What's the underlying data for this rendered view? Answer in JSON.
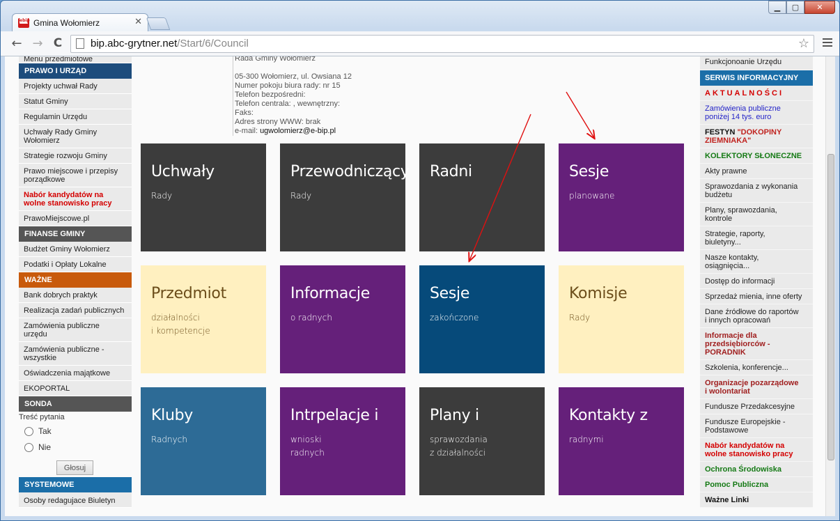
{
  "browser": {
    "tab_title": "Gmina Wołomierz",
    "favicon_text": "ebip",
    "url_host": "bip.abc-grytner.net",
    "url_path": "/Start/6/Council",
    "close_glyph": "✕",
    "min_glyph": "▁",
    "max_glyph": "▢",
    "back_glyph": "←",
    "forward_glyph": "→",
    "reload_glyph": "C",
    "star_glyph": "☆"
  },
  "left_sidebar": {
    "top_item": "Menu przedmiotowe",
    "sections": [
      {
        "header": "PRAWO I URZĄD",
        "color": "#1d4c7c",
        "items": [
          {
            "label": "Projekty uchwał Rady",
            "style": ""
          },
          {
            "label": "Statut Gminy",
            "style": ""
          },
          {
            "label": "Regulamin Urzędu",
            "style": ""
          },
          {
            "label": "Uchwały Rady Gminy\nWołomierz",
            "style": ""
          },
          {
            "label": "Strategie rozwoju Gminy",
            "style": ""
          },
          {
            "label": "Prawo miejscowe i przepisy\nporządkowe",
            "style": ""
          },
          {
            "label": "Nabór kandydatów na\nwolne stanowisko pracy",
            "style": "red"
          },
          {
            "label": "PrawoMiejscowe.pl",
            "style": ""
          }
        ]
      },
      {
        "header": "FINANSE GMINY",
        "color": "#555555",
        "items": [
          {
            "label": "Budżet Gminy Wołomierz",
            "style": ""
          },
          {
            "label": "Podatki i Opłaty Lokalne",
            "style": ""
          }
        ]
      },
      {
        "header": "WAŻNE",
        "color": "#c85a0c",
        "items": [
          {
            "label": "Bank dobrych praktyk",
            "style": ""
          },
          {
            "label": "Realizacja zadań publicznych",
            "style": ""
          },
          {
            "label": "Zamówienia publiczne\nurzędu",
            "style": ""
          },
          {
            "label": "Zamówienia publiczne -\nwszystkie",
            "style": ""
          },
          {
            "label": "Oświadczenia majątkowe",
            "style": ""
          },
          {
            "label": "EKOPORTAL",
            "style": ""
          }
        ]
      }
    ],
    "poll": {
      "header": "SONDA",
      "question": "Treść pytania",
      "options": [
        "Tak",
        "Nie"
      ],
      "button": "Głosuj"
    },
    "system": {
      "header": "SYSTEMOWE",
      "items": [
        "Osoby redagujace Biuletyn"
      ]
    }
  },
  "contact": {
    "name": "Rada Gminy Wołomierz",
    "address": "05-300 Wołomierz, ul. Owsiana 12",
    "room": "Numer pokoju biura rady: nr 15",
    "phone_direct": "Telefon bezpośredni:",
    "phone_central": "Telefon centrala: , wewnętrzny:",
    "fax": "Faks:",
    "www": "Adres strony WWW: brak",
    "email_label": "e-mail: ",
    "email": "ugwolomierz@e-bip.pl"
  },
  "tiles": [
    {
      "title": "Uchwały",
      "subtitle": "Rady",
      "color": "dark"
    },
    {
      "title": "Przewodniczący",
      "subtitle": "Rady",
      "color": "dark"
    },
    {
      "title": "Radni",
      "subtitle": "",
      "color": "dark"
    },
    {
      "title": "Sesje",
      "subtitle": "planowane",
      "color": "purple"
    },
    {
      "title": "Przedmiot",
      "subtitle": "działalności\ni kompetencje",
      "color": "cream"
    },
    {
      "title": "Informacje",
      "subtitle": "o radnych",
      "color": "purple"
    },
    {
      "title": "Sesje",
      "subtitle": "zakończone",
      "color": "navy"
    },
    {
      "title": "Komisje",
      "subtitle": "Rady",
      "color": "cream"
    },
    {
      "title": "Kluby",
      "subtitle": "Radnych",
      "color": "steel"
    },
    {
      "title": "Intrpelacje i",
      "subtitle": "wnioski\nradnych",
      "color": "purple"
    },
    {
      "title": "Plany i",
      "subtitle": "sprawozdania\nz działalności",
      "color": "dark"
    },
    {
      "title": "Kontakty z",
      "subtitle": "radnymi",
      "color": "purple"
    }
  ],
  "right_sidebar": {
    "top_item": "Funkcjonoanie Urzędu",
    "header": "SERWIS INFORMACYJNY",
    "header_color": "#1b6ea8",
    "items": [
      {
        "label": "AKTUALNOŚCI",
        "style": "spaced"
      },
      {
        "label": "Zamówienia publiczne\nponiżej 14 tys. euro",
        "style": "c-blue"
      },
      {
        "label": "FESTYN \"DOKOPINY\nZIEMNIAKA\"",
        "style": "c-festyn"
      },
      {
        "label": "KOLEKTORY SŁONECZNE",
        "style": "c-green"
      },
      {
        "label": "Akty prawne",
        "style": ""
      },
      {
        "label": "Sprawozdania z wykonania\nbudżetu",
        "style": ""
      },
      {
        "label": "Plany, sprawozdania,\nkontrole",
        "style": ""
      },
      {
        "label": "Strategie, raporty,\nbiuletyny...",
        "style": ""
      },
      {
        "label": "Nasze kontakty,\nosiągnięcia...",
        "style": ""
      },
      {
        "label": "Dostęp do informacji",
        "style": ""
      },
      {
        "label": "Sprzedaż mienia, inne oferty",
        "style": ""
      },
      {
        "label": "Dane źródłowe do raportów\ni innych opracowań",
        "style": ""
      },
      {
        "label": "Informacje dla\nprzedsiębiorców -\nPORADNIK",
        "style": "c-maroon"
      },
      {
        "label": "Szkolenia, konferencje...",
        "style": ""
      },
      {
        "label": "Organizacje pozarządowe\ni wolontariat",
        "style": "c-maroon"
      },
      {
        "label": "Fundusze Przedakcesyjne",
        "style": ""
      },
      {
        "label": "Fundusze Europejskie -\nPodstawowe",
        "style": ""
      },
      {
        "label": "Nabór kandydatów na\nwolne stanowisko pracy",
        "style": "c-red"
      },
      {
        "label": "Ochrona Środowiska",
        "style": "c-green"
      },
      {
        "label": "Pomoc Publiczna",
        "style": "c-green"
      },
      {
        "label": "Ważne Linki",
        "style": "c-dark"
      }
    ]
  }
}
